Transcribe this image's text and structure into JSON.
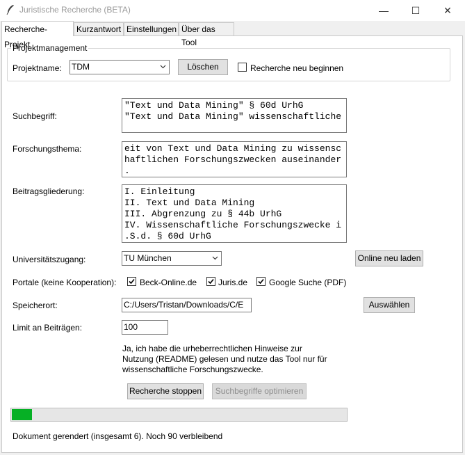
{
  "window": {
    "title": "Juristische Recherche (BETA)",
    "minimize": "—",
    "maximize": "☐",
    "close": "✕"
  },
  "tabs": [
    "Recherche-Projekt",
    "Kurzantwort",
    "Einstellungen",
    "Über das Tool"
  ],
  "projekt": {
    "group_title": "Projektmanagement",
    "name_label": "Projektname:",
    "name_value": "TDM",
    "delete_label": "Löschen",
    "restart_label": "Recherche neu beginnen",
    "restart_checked": false
  },
  "fields": {
    "suchbegriff_label": "Suchbegriff:",
    "suchbegriff_lines": [
      "\"Text und Data Mining\" § 60d UrhG",
      "\"Text und Data Mining\" wissenschaftliche"
    ],
    "thema_label": "Forschungsthema:",
    "thema_lines": [
      "eit von Text und Data Mining zu wissensc",
      "haftlichen Forschungszwecken auseinander",
      "."
    ],
    "gliederung_label": "Beitragsgliederung:",
    "gliederung_lines": [
      "I. Einleitung",
      "II. Text und Data Mining",
      "III. Abgrenzung zu § 44b UrhG",
      "IV. Wissenschaftliche Forschungszwecke i",
      ".S.d. § 60d UrhG"
    ]
  },
  "uni": {
    "label": "Universitätszugang:",
    "value": "TU München",
    "reload_label": "Online neu laden"
  },
  "portale": {
    "label": "Portale (keine Kooperation):",
    "items": [
      {
        "label": "Beck-Online.de",
        "checked": true
      },
      {
        "label": "Juris.de",
        "checked": true
      },
      {
        "label": "Google Suche (PDF)",
        "checked": true
      }
    ]
  },
  "speicherort": {
    "label": "Speicherort:",
    "value": "C:/Users/Tristan/Downloads/C/E",
    "choose_label": "Auswählen"
  },
  "limit": {
    "label": "Limit an Beiträgen:",
    "value": "100"
  },
  "hinweis": [
    "Ja, ich habe die urheberrechtlichen Hinweise zur",
    "Nutzung (README) gelesen und nutze das Tool nur für",
    "wissenschaftliche Forschungszwecke."
  ],
  "actions": {
    "stop_label": "Recherche stoppen",
    "optimize_label": "Suchbegriffe optimieren"
  },
  "progress": {
    "fraction": 0.061
  },
  "status": "Dokument gerendert (insgesamt 6). Noch 90 verbleibend",
  "colors": {
    "progress": "#06b025"
  }
}
